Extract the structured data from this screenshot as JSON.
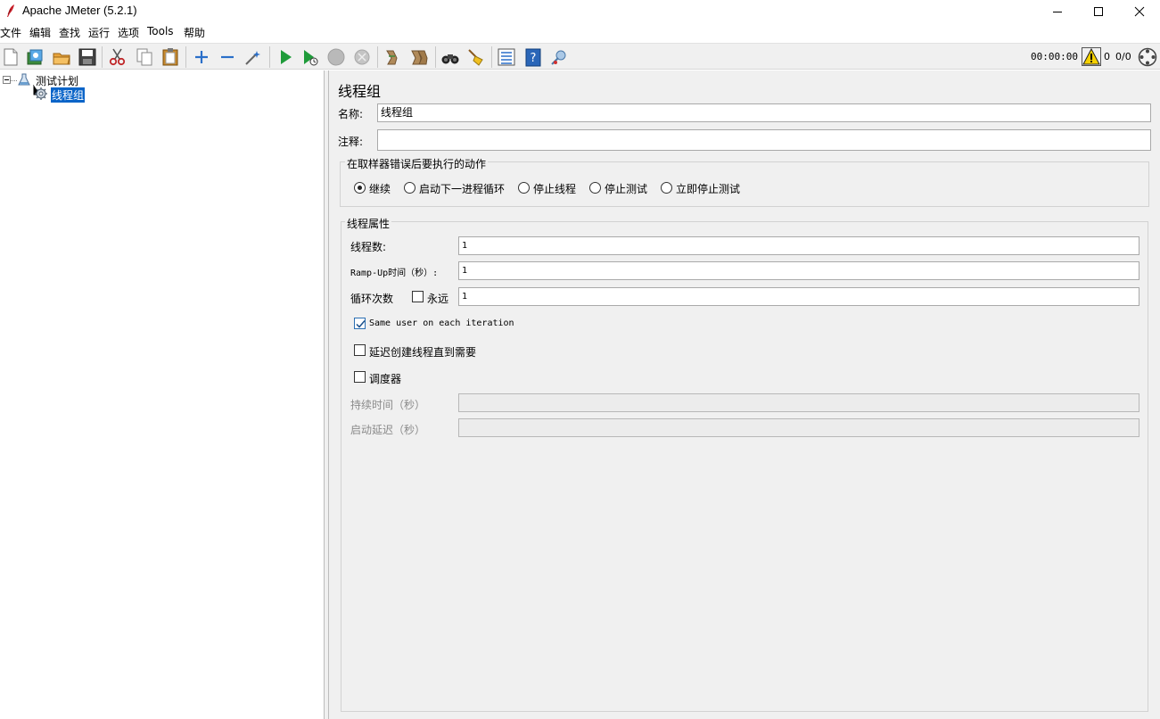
{
  "window": {
    "title": "Apache JMeter (5.2.1)"
  },
  "menu": [
    "文件",
    "编辑",
    "查找",
    "运行",
    "选项",
    "Tools",
    "帮助"
  ],
  "status": {
    "timer": "00:00:00",
    "warnings": "0",
    "threads": "0/0"
  },
  "tree": {
    "root": "测试计划",
    "child": "线程组"
  },
  "panel": {
    "title": "线程组",
    "name_label": "名称:",
    "name_value": "线程组",
    "comment_label": "注释:",
    "comment_value": "",
    "on_error_group": "在取样器错误后要执行的动作",
    "on_error_options": [
      "继续",
      "启动下一进程循环",
      "停止线程",
      "停止测试",
      "立即停止测试"
    ],
    "on_error_selected": "继续",
    "thread_props_group": "线程属性",
    "threads_label": "线程数:",
    "threads_value": "1",
    "rampup_label": "Ramp-Up时间（秒）:",
    "rampup_value": "1",
    "loop_label": "循环次数",
    "forever_label": "永远",
    "forever_checked": false,
    "loop_value": "1",
    "same_user_label": "Same user on each iteration",
    "same_user_checked": true,
    "delay_create_label": "延迟创建线程直到需要",
    "delay_create_checked": false,
    "scheduler_label": "调度器",
    "scheduler_checked": false,
    "duration_label": "持续时间（秒）",
    "duration_value": "",
    "startup_delay_label": "启动延迟（秒）",
    "startup_delay_value": ""
  },
  "colors": {
    "selection": "#0a64c8",
    "panel_bg": "#f0f0f0",
    "run_green": "#1f9b3a"
  }
}
